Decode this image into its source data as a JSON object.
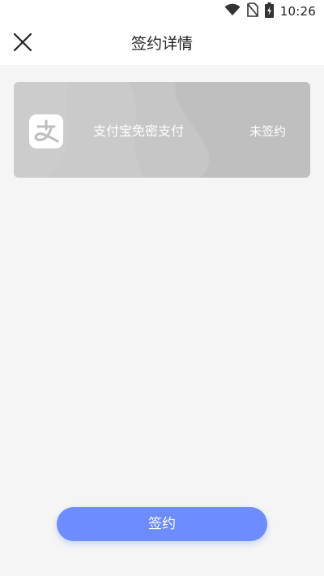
{
  "status_bar": {
    "time": "10:26",
    "icons": [
      "wifi-icon",
      "no-sim-icon",
      "battery-charging-icon"
    ]
  },
  "header": {
    "title": "签约详情",
    "close_icon": "close-icon"
  },
  "card": {
    "name": "支付宝免密支付",
    "status": "未签约",
    "logo_icon": "alipay-logo-icon"
  },
  "footer": {
    "button_label": "签约"
  },
  "colors": {
    "accent": "#6c8cff",
    "card_background": "#c6c6c6",
    "page_background": "#f5f5f5"
  }
}
